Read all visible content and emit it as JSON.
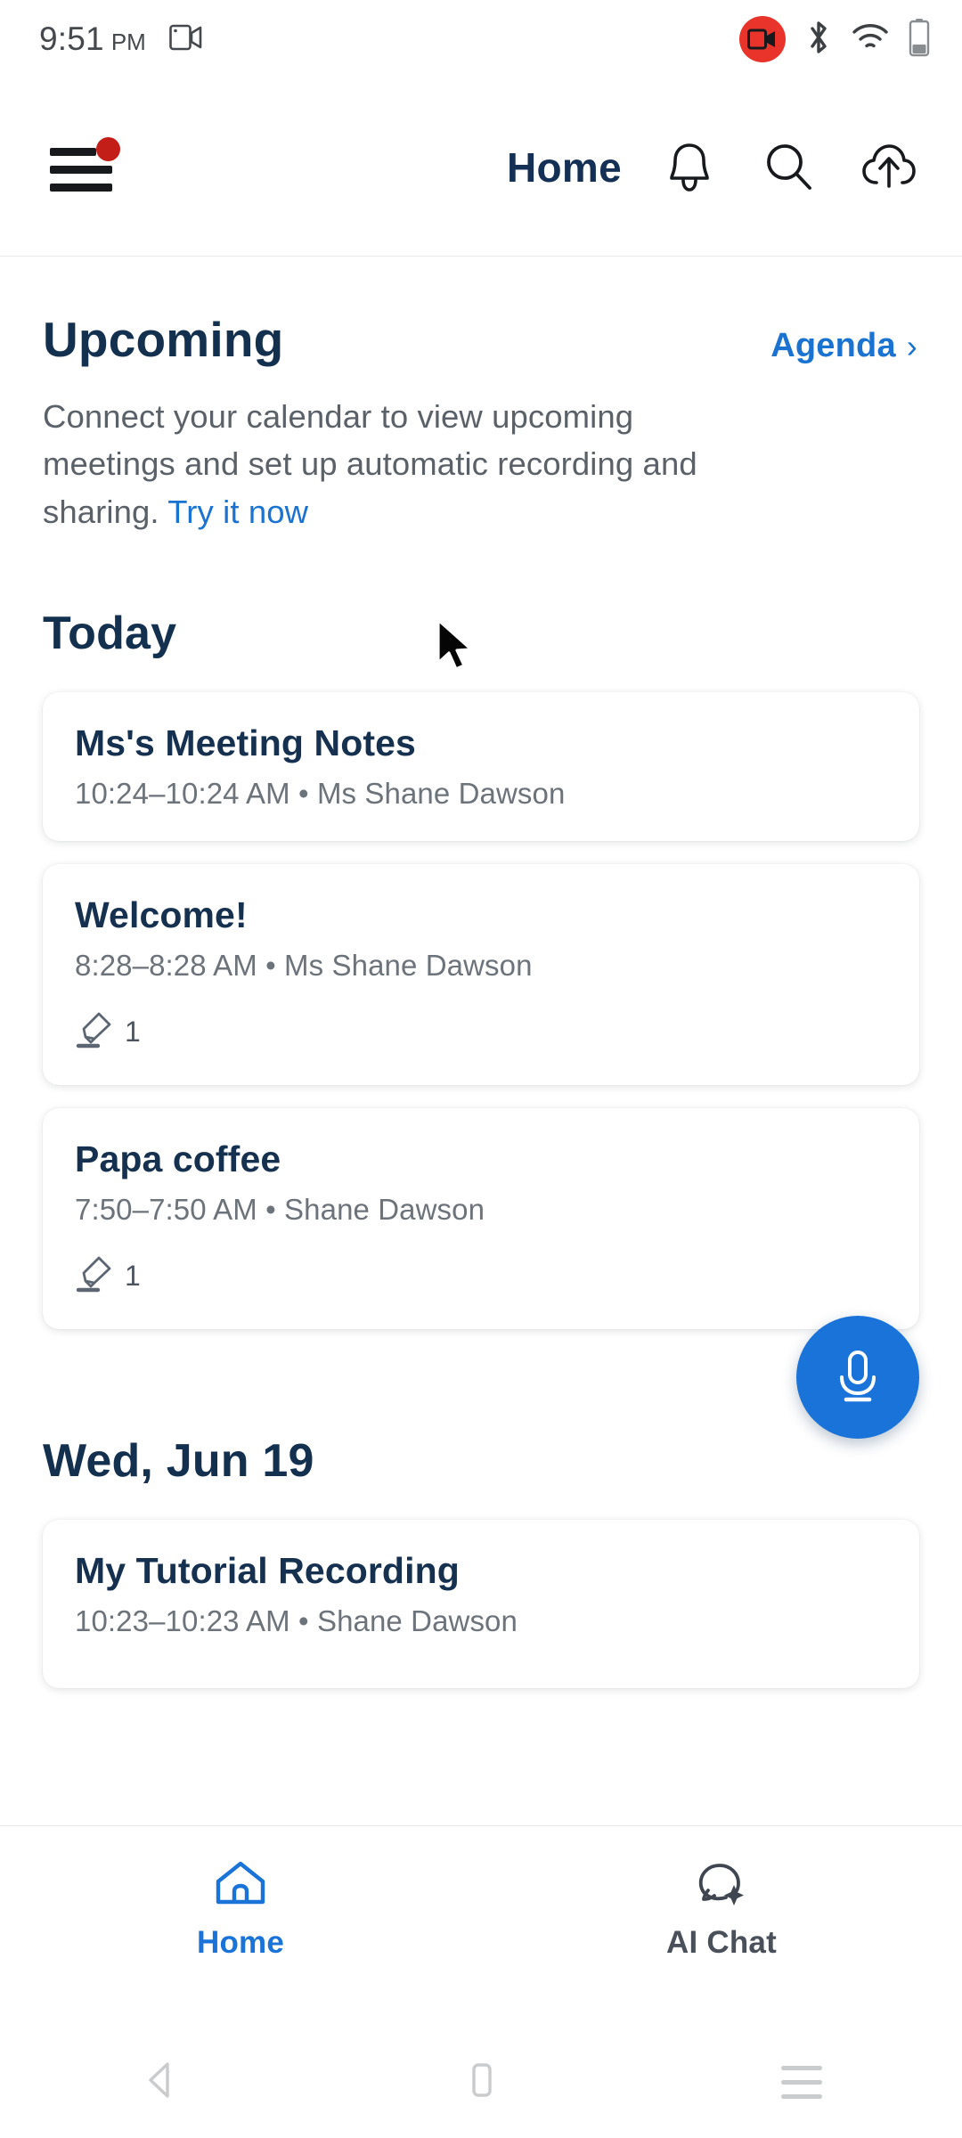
{
  "status_bar": {
    "time": "9:51",
    "am_pm": "PM",
    "screen_record_icon": "video-camera-icon",
    "recording_badge_icon": "recording-video-icon",
    "bluetooth_icon": "bluetooth-icon",
    "wifi_icon": "wifi-icon",
    "battery_icon": "battery-icon"
  },
  "app_bar": {
    "menu_icon": "hamburger-menu-icon",
    "has_notification_dot": true,
    "title": "Home",
    "notifications_icon": "bell-icon",
    "search_icon": "search-icon",
    "upload_icon": "cloud-upload-icon"
  },
  "upcoming": {
    "title": "Upcoming",
    "agenda_label": "Agenda",
    "agenda_chevron": "›",
    "description_part1": "Connect your calendar to view upcoming meetings and set up automatic recording and sharing.",
    "cta_label": "Try it now"
  },
  "sections": [
    {
      "heading": "Today",
      "cards": [
        {
          "title": "Ms's Meeting Notes",
          "subtitle": "10:24–10:24 AM  •  Ms Shane Dawson",
          "highlight_icon": "highlighter-icon",
          "highlight_count": ""
        },
        {
          "title": "Welcome!",
          "subtitle": "8:28–8:28 AM  •  Ms Shane Dawson",
          "highlight_icon": "highlighter-icon",
          "highlight_count": "1"
        },
        {
          "title": "Papa coffee",
          "subtitle": "7:50–7:50 AM  •  Shane Dawson",
          "highlight_icon": "highlighter-icon",
          "highlight_count": "1"
        }
      ]
    },
    {
      "heading": "Wed, Jun 19",
      "cards": [
        {
          "title": "My Tutorial Recording",
          "subtitle": "10:23–10:23 AM  •  Shane Dawson",
          "highlight_icon": "",
          "highlight_count": ""
        }
      ]
    }
  ],
  "fab": {
    "icon": "microphone-icon",
    "color": "#1a73d8"
  },
  "bottom_nav": {
    "items": [
      {
        "label": "Home",
        "icon": "home-icon",
        "active": true
      },
      {
        "label": "AI Chat",
        "icon": "ai-chat-bubble-icon",
        "active": false
      }
    ]
  },
  "android_nav": {
    "back_icon": "back-triangle-icon",
    "home_icon": "home-square-icon",
    "recents_icon": "recents-lines-icon"
  },
  "colors": {
    "accent_blue": "#1a73d8",
    "title_navy": "#14304f",
    "muted_text": "#6c737a",
    "alert_red": "#c41e18"
  }
}
